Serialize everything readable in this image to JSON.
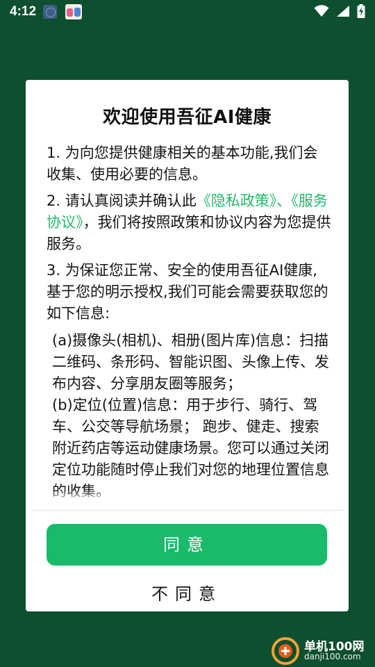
{
  "status_bar": {
    "time": "4:12",
    "icons": [
      "app-icon-1",
      "app-icon-2",
      "wifi-icon",
      "signal-icon",
      "battery-charging-icon"
    ]
  },
  "dialog": {
    "title": "欢迎使用吾征AI健康",
    "items": {
      "p1": "1. 为向您提供健康相关的基本功能,我们会收集、使用必要的信息。",
      "p2_prefix": "2. 请认真阅读并确认此",
      "privacy_link": "《隐私政策》、",
      "service_link": "《服务协议》",
      "p2_suffix": "，我们将按照政策和协议内容为您提供服务。",
      "p3": "3. 为保证您正常、安全的使用吾征AI健康,基于您的明示授权,我们可能会需要获取您的如下信息:",
      "sub_a": "(a)摄像头(相机)、相册(图片库)信息：扫描二维码、条形码、智能识图、头像上传、发布内容、分享朋友圈等服务；",
      "sub_b": "(b)定位(位置)信息：用于步行、骑行、驾车、公交等导航场景； 跑步、健走、搜索附近药店等运动健康场景。您可以通过关闭定位功能随时停止我们对您的地理位置信息的收集。"
    },
    "agree_label": "同意",
    "disagree_label": "不同意"
  },
  "watermark": {
    "title": "单机100网",
    "url": "danji100.com"
  },
  "colors": {
    "background": "#0d4f2e",
    "accent": "#19bb6b",
    "link": "#21b96b"
  }
}
